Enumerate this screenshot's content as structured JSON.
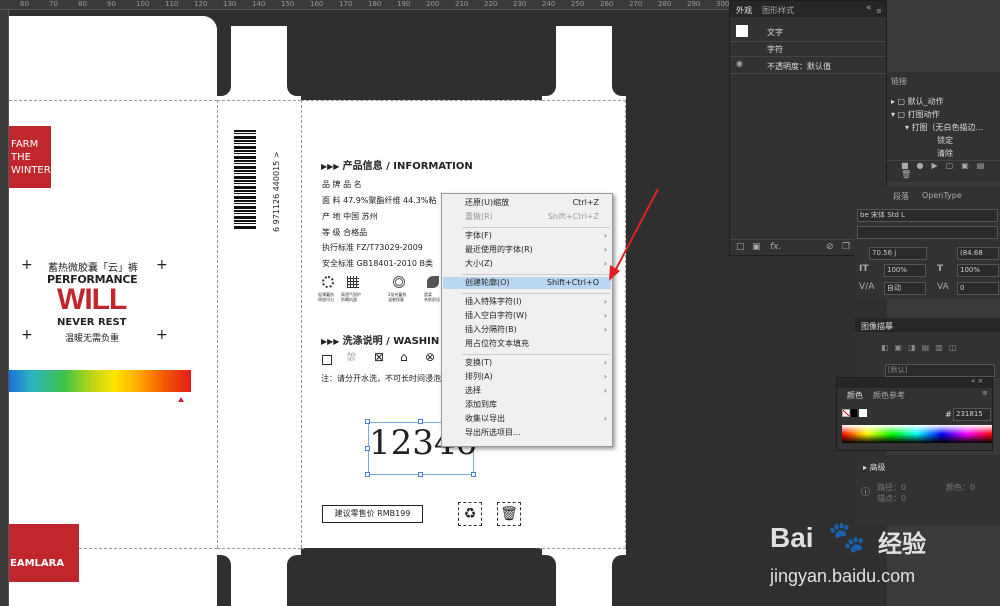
{
  "ruler": {
    "numbers": [
      "60",
      "70",
      "80",
      "90",
      "100",
      "110",
      "120",
      "130",
      "140",
      "150",
      "160",
      "170",
      "180",
      "190",
      "200",
      "210",
      "220",
      "230",
      "240",
      "250",
      "260",
      "270",
      "280",
      "290",
      "300"
    ]
  },
  "artboard": {
    "logo_lines": [
      "FARM",
      "THE",
      "WINTER"
    ],
    "subtitle": "蓄热微胶囊「云」裤",
    "performance": "PERFORMANCE",
    "will": "WILL",
    "never_rest": "NEVER REST",
    "tagline": "温暖无需负重",
    "brand_bottom": "EAMLARA",
    "barcode_number": "6 971126 440015 >",
    "info_heading_prefix": "▶▶▶",
    "info_heading": "产品信息 / INFORMATION",
    "info_rows": [
      "品 牌                    品 名",
      "面 料  47.9%聚酯纤维  44.3%粘",
      "产 地  中国 苏州",
      "等 级  合格品",
      "执行标准  FZ/T73029-2009",
      "安全标准  GB18401-2010 B类"
    ],
    "feature_labels": [
      "轻薄蓄热\n释放均匀",
      "高透气保护\n防霉抗菌",
      "2倍充蓄热\n温感保暖",
      "超柔\n亲肤舒适"
    ],
    "wash_heading": "洗涤说明 / WASHIN",
    "wash_note": "注：请分开水洗，不可长时间浸泡",
    "number_text": "12346",
    "price_label": "建议零售价  RMB199"
  },
  "context_menu": {
    "items": [
      {
        "label": "还原(U)缩放",
        "shortcut": "Ctrl+Z",
        "submenu": false,
        "disabled": false,
        "highlight": false
      },
      {
        "label": "重做(R)",
        "shortcut": "Shift+Ctrl+Z",
        "submenu": false,
        "disabled": true,
        "highlight": false
      },
      {
        "label": "字体(F)",
        "shortcut": "",
        "submenu": true,
        "disabled": false,
        "highlight": false
      },
      {
        "label": "最近使用的字体(R)",
        "shortcut": "",
        "submenu": true,
        "disabled": false,
        "highlight": false
      },
      {
        "label": "大小(Z)",
        "shortcut": "",
        "submenu": true,
        "disabled": false,
        "highlight": false
      },
      {
        "label": "创建轮廓(O)",
        "shortcut": "Shift+Ctrl+O",
        "submenu": false,
        "disabled": false,
        "highlight": true
      },
      {
        "label": "插入特殊字符(I)",
        "shortcut": "",
        "submenu": true,
        "disabled": false,
        "highlight": false
      },
      {
        "label": "插入空白字符(W)",
        "shortcut": "",
        "submenu": true,
        "disabled": false,
        "highlight": false
      },
      {
        "label": "插入分隔符(B)",
        "shortcut": "",
        "submenu": true,
        "disabled": false,
        "highlight": false
      },
      {
        "label": "用占位符文本填充",
        "shortcut": "",
        "submenu": false,
        "disabled": false,
        "highlight": false
      },
      {
        "label": "变换(T)",
        "shortcut": "",
        "submenu": true,
        "disabled": false,
        "highlight": false
      },
      {
        "label": "排列(A)",
        "shortcut": "",
        "submenu": true,
        "disabled": false,
        "highlight": false
      },
      {
        "label": "选择",
        "shortcut": "",
        "submenu": true,
        "disabled": false,
        "highlight": false
      },
      {
        "label": "添加到库",
        "shortcut": "",
        "submenu": false,
        "disabled": false,
        "highlight": false
      },
      {
        "label": "收集以导出",
        "shortcut": "",
        "submenu": true,
        "disabled": false,
        "highlight": false
      },
      {
        "label": "导出所选项目...",
        "shortcut": "",
        "submenu": false,
        "disabled": false,
        "highlight": false
      }
    ]
  },
  "appearance_panel": {
    "tabs": [
      "外观",
      "图形样式"
    ],
    "rows": [
      "文字",
      "字符",
      "不透明度：默认值"
    ]
  },
  "actions_panel": {
    "title": "链接",
    "items": [
      "默认_动作",
      "打图动作",
      "打图（无白色描边...",
      "锁定",
      "清除"
    ]
  },
  "character_panel": {
    "tabs": [
      "段落",
      "OpenType"
    ],
    "font": "be 宋体 Std L",
    "size1": "70.56 j",
    "size2": "(84.68",
    "scale_v": "100%",
    "scale_h": "100%",
    "auto": "自动",
    "tracking": "0"
  },
  "image_trace_panel": {
    "title": "图像描摹",
    "preset": "[默认]"
  },
  "color_panel": {
    "tabs": [
      "颜色",
      "颜色参考"
    ],
    "hex_label": "#",
    "hex": "231815"
  },
  "advanced_panel": {
    "label": "高级",
    "path_label": "路径：0",
    "anchor_label": "锚点：0",
    "color_label": "颜色：0"
  },
  "watermark": {
    "brand": "Bai",
    "brand2": "经验",
    "url": "jingyan.baidu.com"
  },
  "colors": {
    "brand_red": "#c0272d",
    "highlight": "#b9d7f2",
    "arrow": "#e02020"
  }
}
